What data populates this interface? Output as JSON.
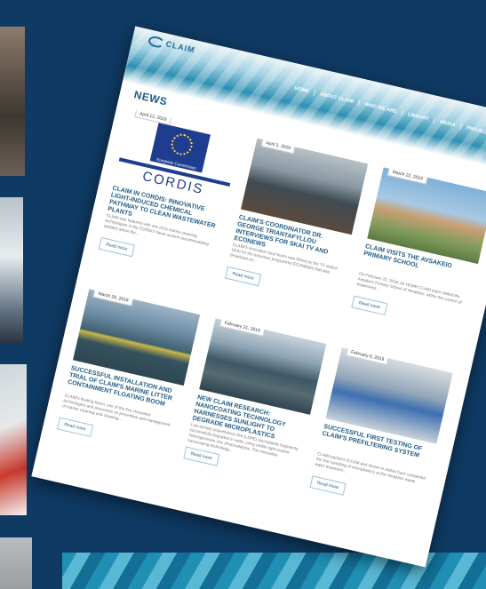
{
  "site": {
    "logo_text": "CLAIM"
  },
  "nav": {
    "items": [
      "HOME",
      "ABOUT CLAIM",
      "WHO WE ARE",
      "LIBRARY",
      "MEDIA",
      "PROJECT AREA"
    ]
  },
  "page_title": "NEWS",
  "read_more_label": "Read more",
  "cards": [
    {
      "date": "April 12, 2019",
      "title": "CLAIM IN CORDIS: INNOVATIVE LIGHT-INDUCED CHEMICAL PATHWAY TO CLEAN WASTEWATER PLANTS",
      "excerpt": "CLAIM was featured with one of its marine cleaning technologies in the CORDIS News section accommodating updates about the...",
      "image_caption": "CORDIS",
      "image_subcaption": "European Commission"
    },
    {
      "date": "April 1, 2019",
      "title": "CLAIM'S COORDINATOR DR. GEORGE TRIANTAFYLLOU INTERVIEWS FOR SKAI TV AND ECONEWS",
      "excerpt": "CLAIM's innovative local boom was filmed by the TV station SKAI for the television programme ECONEWS that was broadcast on..."
    },
    {
      "date": "March 22, 2019",
      "title": "CLAIM VISITS THE AVSAKEIO PRIMARY SCHOOL",
      "excerpt": "On February 22, 2019, an HCMR CLAIM team visited the Avsakeio Primary School of Heraklion, within the context of Awareness..."
    },
    {
      "date": "March 20, 2019",
      "title": "SUCCESSFUL INSTALLATION AND TRIAL OF CLAIM'S MARINE LITTER CONTAINMENT FLOATING BOOM",
      "excerpt": "CLAIM's floating boom, one of the five innovative technologies and processes on prevention and management of marine cleaning and cleaning..."
    },
    {
      "date": "February 21, 2019",
      "title": "NEW CLAIM RESEARCH: NANOCOATING TECHNOLOGY HARNESSES SUNLIGHT TO DEGRADE MICROPLASTICS",
      "excerpt": "Low density polyethylene film (LDPE) microplastic fragments, successfully degraded in water using visible light excited heterogeneous zinc photocatalysis. The innovative nanocoating technology..."
    },
    {
      "date": "February 6, 2019",
      "title": "SUCCESSFUL FIRST TESTING OF CLAIM'S PREFILTERING SYSTEM",
      "excerpt": "CLAIM partners ICCAM and Vessel in Hellas have completed the first sampling of microplastics at the Heraklion waste water treatment..."
    }
  ],
  "colors": {
    "banner": "#2e8fb2",
    "title": "#1f5c84",
    "background": "#0f3a63"
  }
}
